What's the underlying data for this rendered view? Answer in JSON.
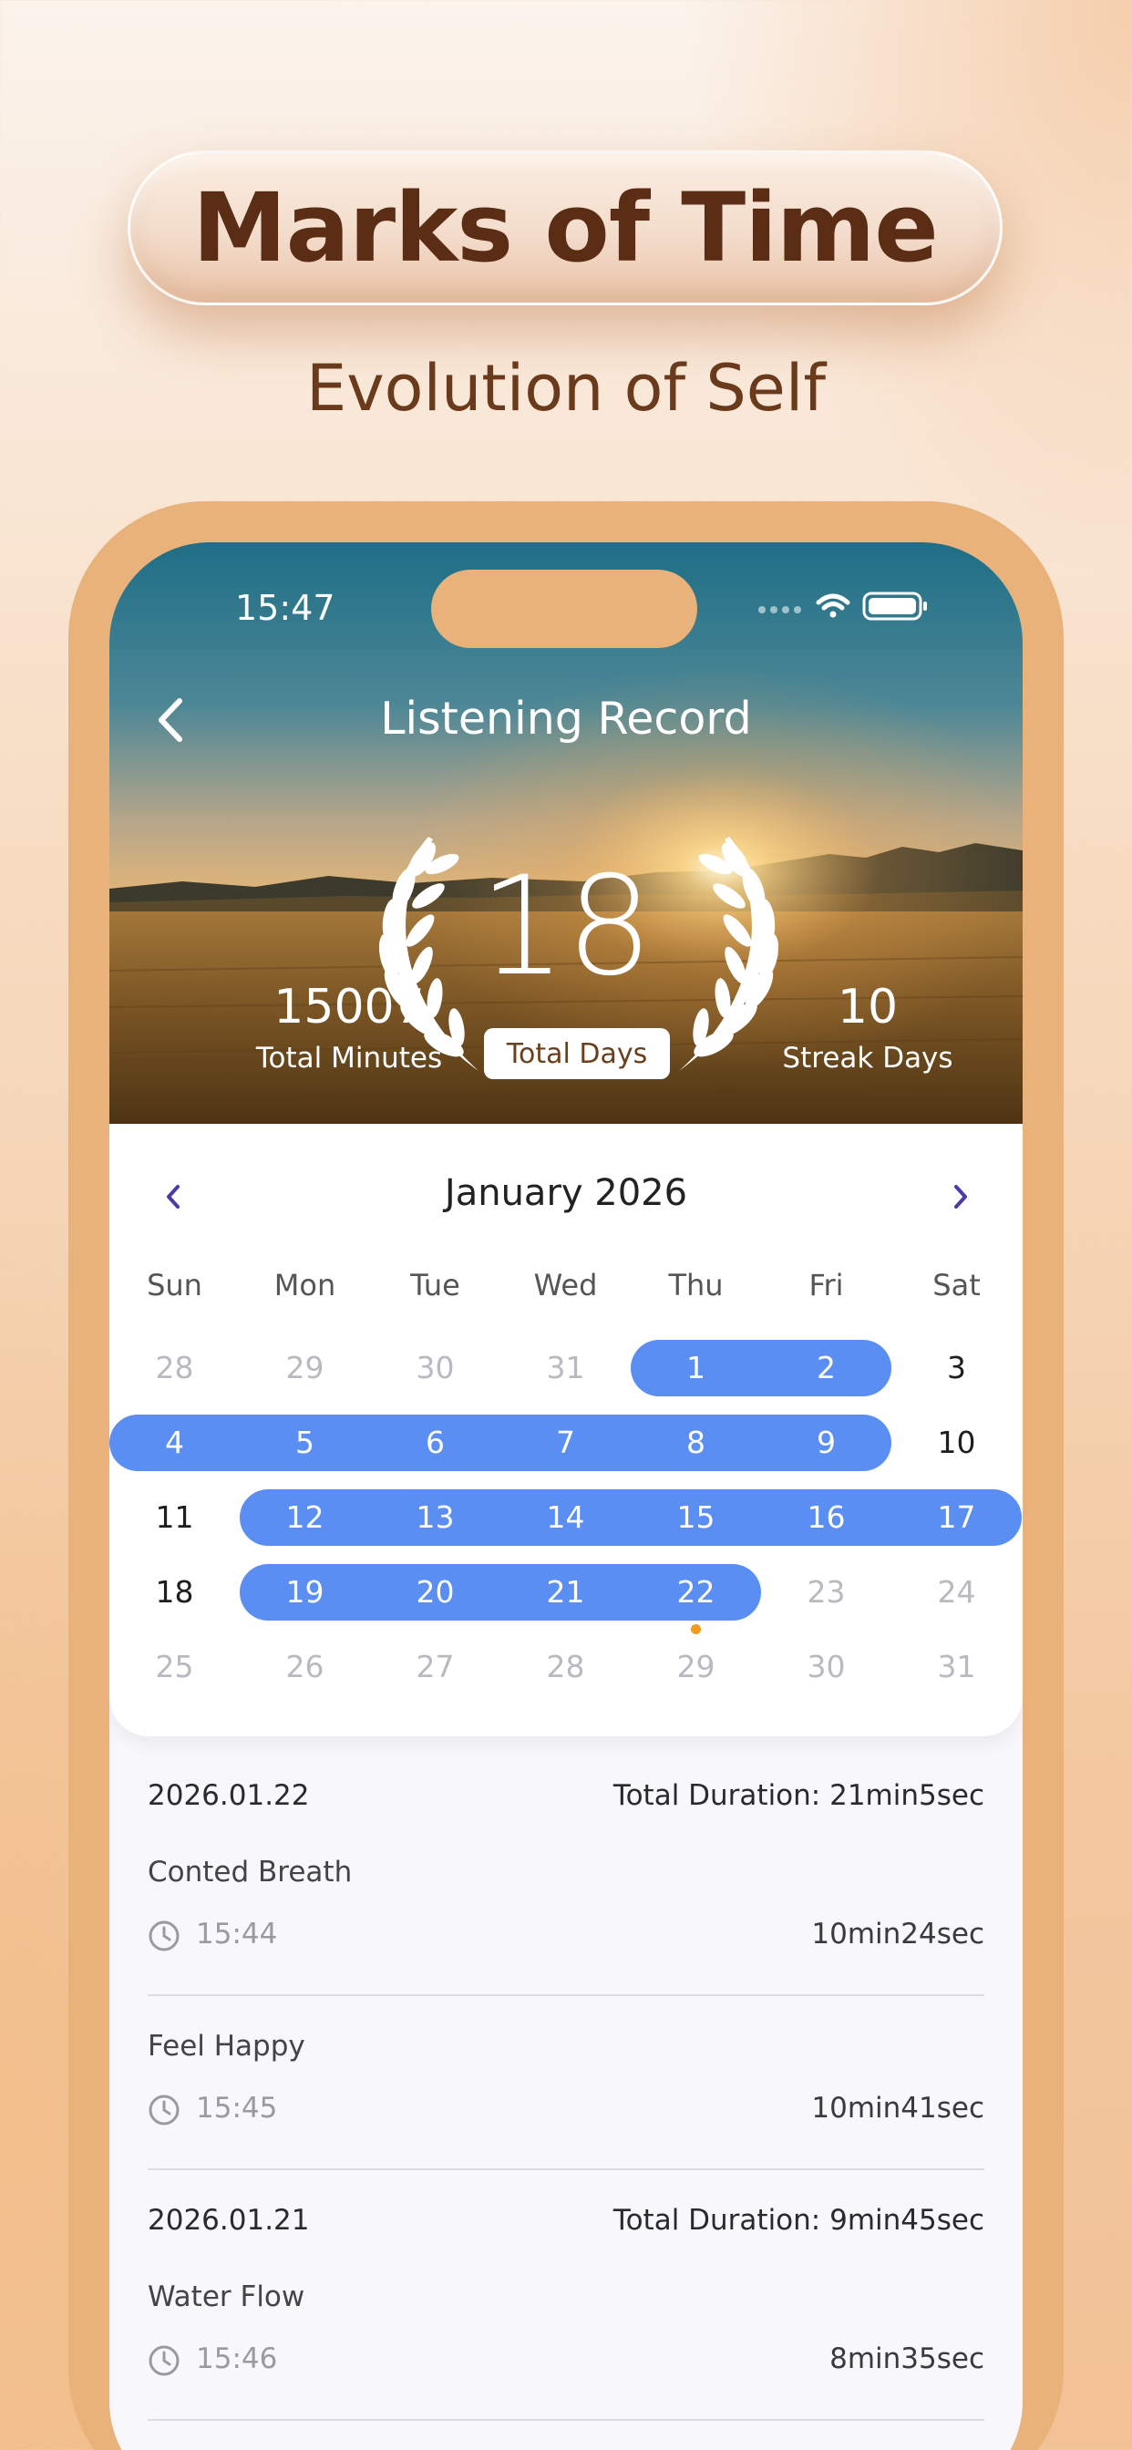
{
  "promo": {
    "title": "Marks of Time",
    "subtitle": "Evolution of Self"
  },
  "status_bar": {
    "time": "15:47",
    "icons": [
      "signal-icon",
      "wifi-icon",
      "battery-icon"
    ]
  },
  "header": {
    "title": "Listening Record",
    "back_icon": "chevron-left-icon"
  },
  "stats": {
    "total_days": "18",
    "total_days_label": "Total Days",
    "total_minutes": "15007",
    "total_minutes_label": "Total Minutes",
    "streak_days": "10",
    "streak_days_label": "Streak Days"
  },
  "calendar": {
    "month_label": "January 2026",
    "prev_icon": "chevron-left-icon",
    "next_icon": "chevron-right-icon",
    "weekdays": [
      "Sun",
      "Mon",
      "Tue",
      "Wed",
      "Thu",
      "Fri",
      "Sat"
    ],
    "weeks": [
      [
        {
          "d": "28",
          "s": "muted"
        },
        {
          "d": "29",
          "s": "muted"
        },
        {
          "d": "30",
          "s": "muted"
        },
        {
          "d": "31",
          "s": "muted"
        },
        {
          "d": "1",
          "s": "active"
        },
        {
          "d": "2",
          "s": "active"
        },
        {
          "d": "3",
          "s": "normal"
        }
      ],
      [
        {
          "d": "4",
          "s": "active"
        },
        {
          "d": "5",
          "s": "active"
        },
        {
          "d": "6",
          "s": "active"
        },
        {
          "d": "7",
          "s": "active"
        },
        {
          "d": "8",
          "s": "active"
        },
        {
          "d": "9",
          "s": "active"
        },
        {
          "d": "10",
          "s": "normal"
        }
      ],
      [
        {
          "d": "11",
          "s": "normal"
        },
        {
          "d": "12",
          "s": "active"
        },
        {
          "d": "13",
          "s": "active"
        },
        {
          "d": "14",
          "s": "active"
        },
        {
          "d": "15",
          "s": "active"
        },
        {
          "d": "16",
          "s": "active"
        },
        {
          "d": "17",
          "s": "active"
        }
      ],
      [
        {
          "d": "18",
          "s": "normal"
        },
        {
          "d": "19",
          "s": "active"
        },
        {
          "d": "20",
          "s": "active"
        },
        {
          "d": "21",
          "s": "active"
        },
        {
          "d": "22",
          "s": "active",
          "today": true
        },
        {
          "d": "23",
          "s": "muted"
        },
        {
          "d": "24",
          "s": "muted"
        }
      ],
      [
        {
          "d": "25",
          "s": "muted"
        },
        {
          "d": "26",
          "s": "muted"
        },
        {
          "d": "27",
          "s": "muted"
        },
        {
          "d": "28",
          "s": "muted"
        },
        {
          "d": "29",
          "s": "muted"
        },
        {
          "d": "30",
          "s": "muted"
        },
        {
          "d": "31",
          "s": "muted"
        }
      ]
    ],
    "accent_color": "#5b8ef2",
    "today_dot_color": "#f39a1e"
  },
  "records": [
    {
      "date": "2026.01.22",
      "total": "Total Duration: 21min5sec",
      "items": [
        {
          "name": "Conted Breath",
          "time": "15:44",
          "duration": "10min24sec"
        },
        {
          "name": "Feel Happy",
          "time": "15:45",
          "duration": "10min41sec"
        }
      ]
    },
    {
      "date": "2026.01.21",
      "total": "Total Duration: 9min45sec",
      "items": [
        {
          "name": "Water Flow",
          "time": "15:46",
          "duration": "8min35sec"
        }
      ]
    }
  ]
}
